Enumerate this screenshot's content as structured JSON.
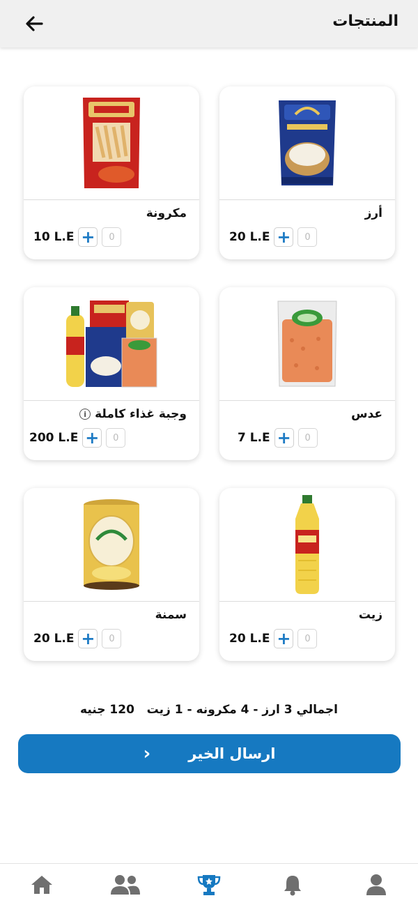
{
  "header": {
    "title": "المنتجات"
  },
  "products": [
    {
      "name": "أرز",
      "price": "20 L.E",
      "qty": "0"
    },
    {
      "name": "مكرونة",
      "price": "10 L.E",
      "qty": "0"
    },
    {
      "name": "عدس",
      "price": "7 L.E",
      "qty": "0"
    },
    {
      "name": "وجبة غذاء كاملة",
      "price": "200 L.E",
      "qty": "0"
    },
    {
      "name": "زيت",
      "price": "20 L.E",
      "qty": "0"
    },
    {
      "name": "سمنة",
      "price": "20 L.E",
      "qty": "0"
    }
  ],
  "summary": {
    "text": "اجمالي 3 ارز - 4 مكرونه - 1 زيت",
    "amount": "120 جنيه"
  },
  "send_button": {
    "label": "ارسال الخير"
  },
  "nav": {
    "items": [
      "profile-icon",
      "bell-icon",
      "trophy-icon",
      "group-icon",
      "home-icon"
    ],
    "active": "trophy-icon"
  },
  "colors": {
    "accent": "#1679c1",
    "inactive_icon": "#6f6f6f"
  }
}
